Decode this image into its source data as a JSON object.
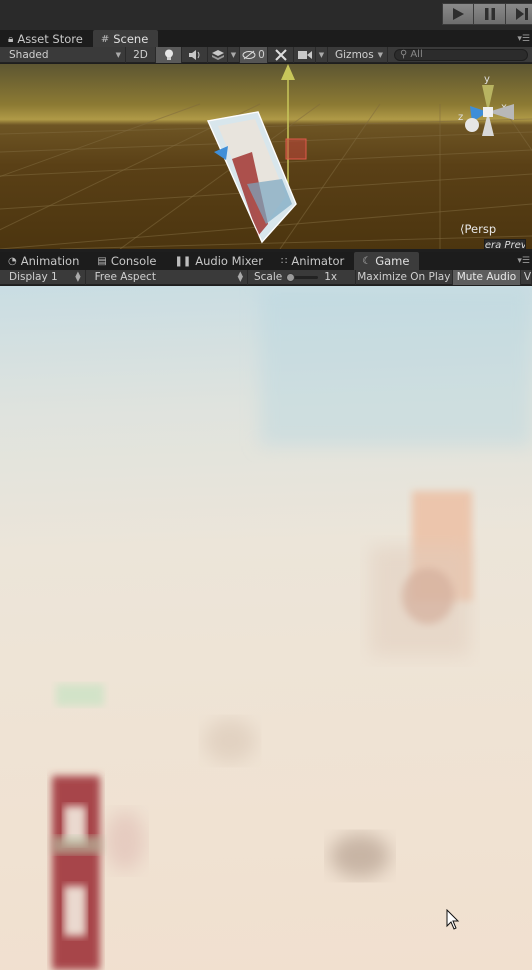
{
  "editor": {
    "play_controls": [
      "play-icon",
      "pause-icon",
      "step-icon"
    ]
  },
  "top_tabs": {
    "asset_store": "Asset Store",
    "scene": "Scene"
  },
  "scene_toolbar": {
    "draw_mode": "Shaded",
    "mode_2d": "2D",
    "hidden_count": "0",
    "gizmos": "Gizmos",
    "search_placeholder": "All"
  },
  "scene_view": {
    "axis_y": "y",
    "axis_x": "x",
    "axis_z": "z",
    "projection": "Persp",
    "camera_preview_title": "Camera Preview"
  },
  "bottom_tabs": {
    "animation": "Animation",
    "console": "Console",
    "audio_mixer": "Audio Mixer",
    "animator": "Animator",
    "game": "Game"
  },
  "game_toolbar": {
    "display": "Display 1",
    "aspect": "Free Aspect",
    "scale_label": "Scale",
    "scale_value": "1x",
    "maximize_on_play": "Maximize On Play",
    "mute_audio": "Mute Audio",
    "extra": "V"
  },
  "colors": {
    "accent_selected": "#5e5e5e",
    "panel_bg": "#3a3a3a",
    "tab_bg": "#1c1c1c"
  }
}
